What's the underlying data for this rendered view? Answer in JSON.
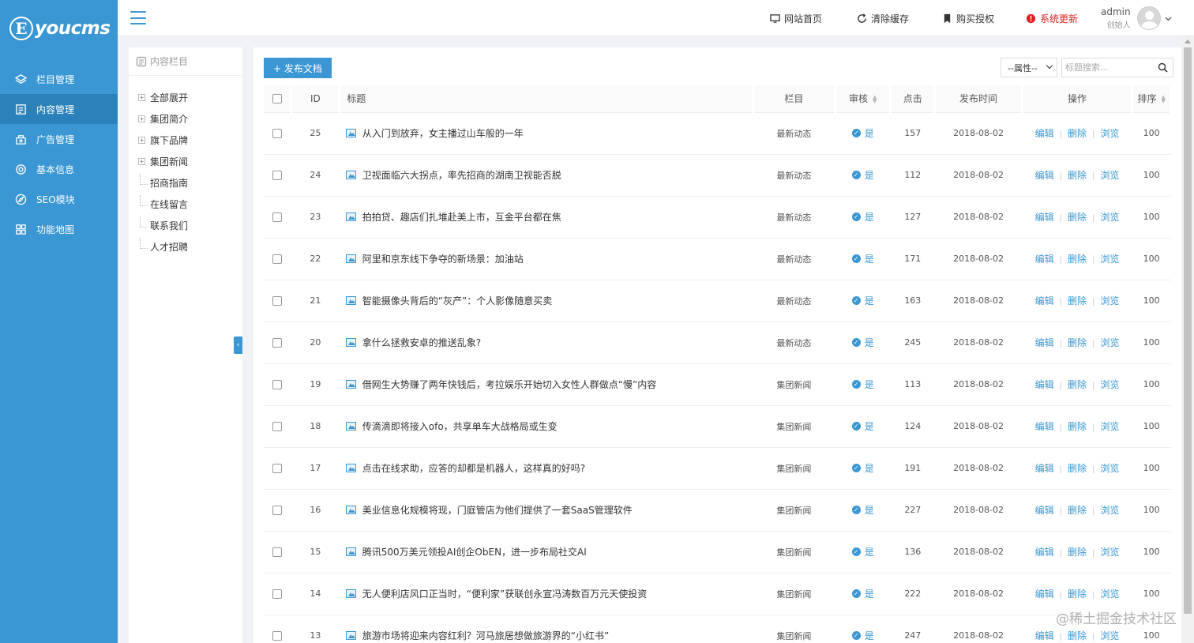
{
  "logo": {
    "initial": "E",
    "text": "youcms"
  },
  "sidebar": {
    "items": [
      {
        "label": "栏目管理",
        "icon": "layers-icon",
        "active": false
      },
      {
        "label": "内容管理",
        "icon": "document-icon",
        "active": true
      },
      {
        "label": "广告管理",
        "icon": "ad-icon",
        "active": false
      },
      {
        "label": "基本信息",
        "icon": "gear-icon",
        "active": false
      },
      {
        "label": "SEO模块",
        "icon": "compass-icon",
        "active": false
      },
      {
        "label": "功能地图",
        "icon": "grid-icon",
        "active": false
      }
    ]
  },
  "topbar": {
    "links": [
      {
        "label": "网站首页",
        "icon": "monitor-icon"
      },
      {
        "label": "清除缓存",
        "icon": "refresh-icon"
      },
      {
        "label": "购买授权",
        "icon": "bookmark-icon"
      },
      {
        "label": "系统更新",
        "icon": "alert-icon",
        "color": "#e02020"
      }
    ],
    "user": {
      "name": "admin",
      "role": "创始人"
    }
  },
  "tree": {
    "header": "内容栏目",
    "items": [
      {
        "label": "全部展开",
        "toggle": "+",
        "child": false
      },
      {
        "label": "集团简介",
        "toggle": "+",
        "child": false
      },
      {
        "label": "旗下品牌",
        "toggle": "+",
        "child": false
      },
      {
        "label": "集团新闻",
        "toggle": "+",
        "child": false
      },
      {
        "label": "招商指南",
        "toggle": "",
        "child": true
      },
      {
        "label": "在线留言",
        "toggle": "",
        "child": true
      },
      {
        "label": "联系我们",
        "toggle": "",
        "child": true
      },
      {
        "label": "人才招聘",
        "toggle": "",
        "child": true
      }
    ],
    "collapse_icon": "‹"
  },
  "toolbar": {
    "publish_label": "+ 发布文档",
    "attr_select": "--属性--",
    "search_placeholder": "标题搜索..."
  },
  "table": {
    "headers": {
      "id": "ID",
      "title": "标题",
      "column": "栏目",
      "audit": "审核",
      "clicks": "点击",
      "date": "发布时间",
      "ops": "操作",
      "sort": "排序"
    },
    "op_labels": {
      "edit": "编辑",
      "delete": "删除",
      "view": "浏览"
    },
    "rows": [
      {
        "id": "25",
        "title": "从入门到放弃，女主播过山车般的一年",
        "column": "最新动态",
        "audit": "是",
        "clicks": "157",
        "date": "2018-08-02",
        "sort": "100"
      },
      {
        "id": "24",
        "title": "卫视面临六大拐点，率先招商的湖南卫视能否脱",
        "column": "最新动态",
        "audit": "是",
        "clicks": "112",
        "date": "2018-08-02",
        "sort": "100"
      },
      {
        "id": "23",
        "title": "拍拍贷、趣店们扎堆赴美上市，互金平台都在焦",
        "column": "最新动态",
        "audit": "是",
        "clicks": "127",
        "date": "2018-08-02",
        "sort": "100"
      },
      {
        "id": "22",
        "title": "阿里和京东线下争夺的新场景：加油站",
        "column": "最新动态",
        "audit": "是",
        "clicks": "171",
        "date": "2018-08-02",
        "sort": "100"
      },
      {
        "id": "21",
        "title": "智能摄像头背后的“灰产”：个人影像随意买卖",
        "column": "最新动态",
        "audit": "是",
        "clicks": "163",
        "date": "2018-08-02",
        "sort": "100"
      },
      {
        "id": "20",
        "title": "拿什么拯救安卓的推送乱象?",
        "column": "最新动态",
        "audit": "是",
        "clicks": "245",
        "date": "2018-08-02",
        "sort": "100"
      },
      {
        "id": "19",
        "title": "借网生大势赚了两年快钱后，考拉娱乐开始切入女性人群做点“慢”内容",
        "column": "集团新闻",
        "audit": "是",
        "clicks": "113",
        "date": "2018-08-02",
        "sort": "100"
      },
      {
        "id": "18",
        "title": "传滴滴即将接入ofo，共享单车大战格局或生变",
        "column": "集团新闻",
        "audit": "是",
        "clicks": "124",
        "date": "2018-08-02",
        "sort": "100"
      },
      {
        "id": "17",
        "title": "点击在线求助，应答的却都是机器人，这样真的好吗?",
        "column": "集团新闻",
        "audit": "是",
        "clicks": "191",
        "date": "2018-08-02",
        "sort": "100"
      },
      {
        "id": "16",
        "title": "美业信息化规模将现，门庭管店为他们提供了一套SaaS管理软件",
        "column": "集团新闻",
        "audit": "是",
        "clicks": "227",
        "date": "2018-08-02",
        "sort": "100"
      },
      {
        "id": "15",
        "title": "腾讯500万美元领投AI创企ObEN，进一步布局社交AI",
        "column": "集团新闻",
        "audit": "是",
        "clicks": "136",
        "date": "2018-08-02",
        "sort": "100"
      },
      {
        "id": "14",
        "title": "无人便利店风口正当时，“便利家”获联创永宣冯涛数百万元天使投资",
        "column": "集团新闻",
        "audit": "是",
        "clicks": "222",
        "date": "2018-08-02",
        "sort": "100"
      },
      {
        "id": "13",
        "title": "旅游市场将迎来内容红利？河马旅居想做旅游界的“小红书”",
        "column": "集团新闻",
        "audit": "是",
        "clicks": "247",
        "date": "2018-08-02",
        "sort": "100"
      }
    ]
  },
  "watermark": "@稀土掘金技术社区",
  "colors": {
    "accent": "#3a97d3",
    "sidebar_active": "#2b82bb",
    "alert": "#e02020"
  }
}
